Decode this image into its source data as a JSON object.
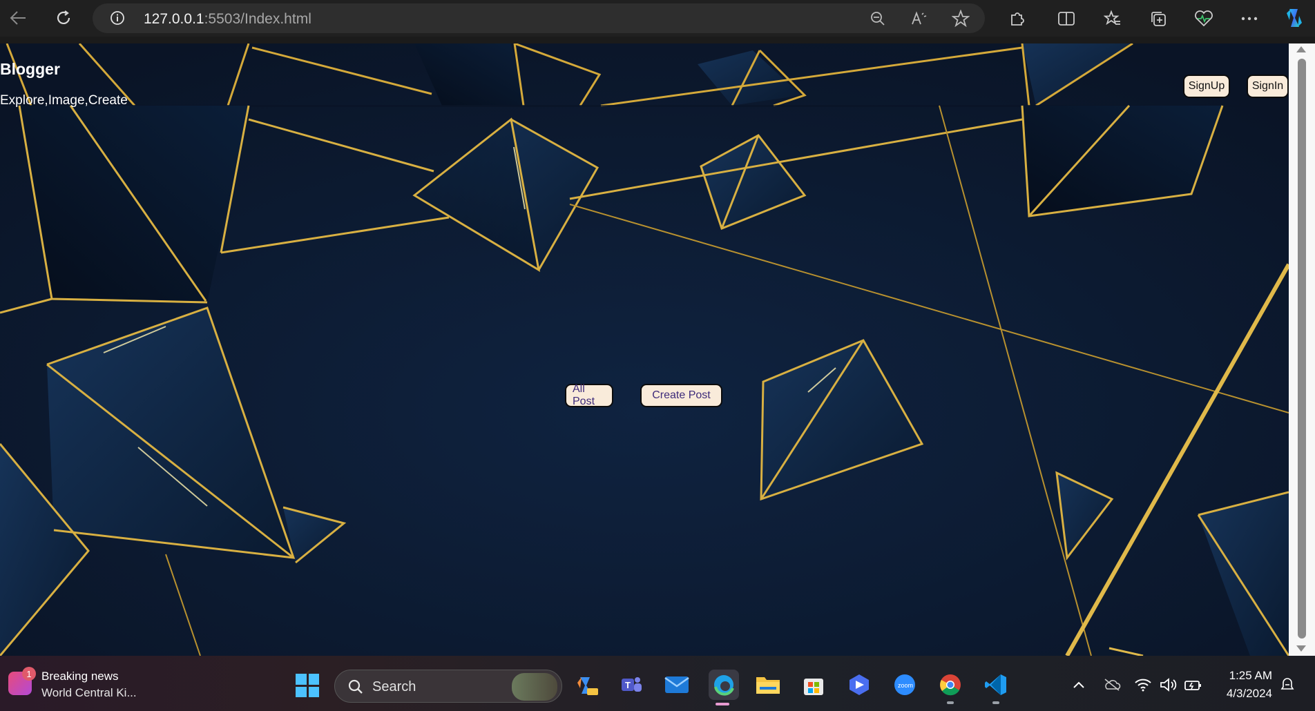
{
  "browser": {
    "url_host": "127.0.0.1",
    "url_rest": ":5503/Index.html"
  },
  "page": {
    "brand": "Blogger",
    "tagline": "Explore,Image,Create",
    "signup_label": "SignUp",
    "signin_label": "SignIn",
    "all_post_label": "All Post",
    "create_post_label": "Create Post",
    "colors": {
      "background": "#0d1a30",
      "gold": "#d9b54a",
      "button_bg": "#f9ebda"
    }
  },
  "taskbar": {
    "news_title": "Breaking news",
    "news_sub": "World Central Ki...",
    "news_badge": "1",
    "search_label": "Search",
    "time": "1:25 AM",
    "date": "4/3/2024"
  }
}
